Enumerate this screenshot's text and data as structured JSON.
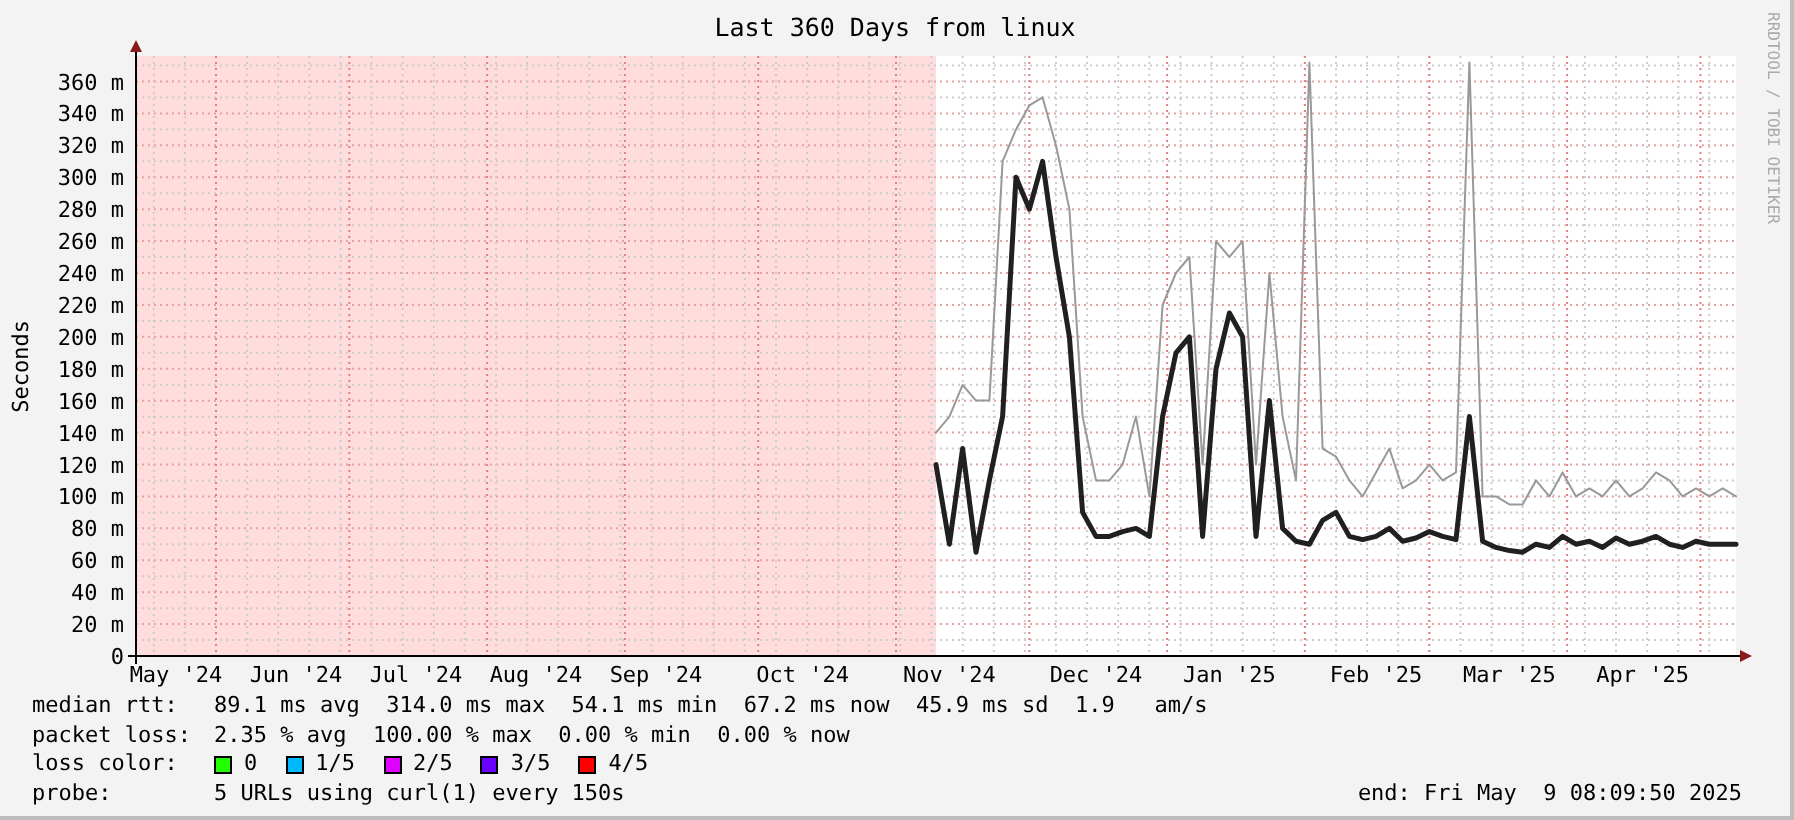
{
  "graph": {
    "chart_data": {
      "type": "line",
      "title": "Last 360 Days from linux",
      "ylabel": "Seconds",
      "ylim": [
        0,
        376
      ],
      "grid": true,
      "categories": [
        null,
        null,
        null,
        "May '24",
        null,
        null,
        null,
        null,
        null,
        null,
        null,
        null,
        "Jun '24",
        null,
        null,
        null,
        null,
        null,
        null,
        null,
        null,
        "Jul '24",
        null,
        null,
        null,
        null,
        null,
        null,
        null,
        null,
        "Aug '24",
        null,
        null,
        null,
        null,
        null,
        null,
        null,
        null,
        "Sep '24",
        null,
        null,
        null,
        null,
        null,
        null,
        null,
        null,
        null,
        null,
        "Oct '24",
        null,
        null,
        null,
        null,
        null,
        null,
        null,
        null,
        null,
        null,
        "Nov '24",
        null,
        null,
        null,
        null,
        null,
        null,
        null,
        null,
        null,
        null,
        "Dec '24",
        null,
        null,
        null,
        null,
        null,
        null,
        null,
        null,
        null,
        "Jan '25",
        null,
        null,
        null,
        null,
        null,
        null,
        null,
        null,
        null,
        null,
        "Feb '25",
        null,
        null,
        null,
        null,
        null,
        null,
        null,
        null,
        null,
        "Mar '25",
        null,
        null,
        null,
        null,
        null,
        null,
        null,
        null,
        null,
        "Apr '25",
        null,
        null,
        null,
        null,
        null,
        null,
        null
      ],
      "yticks": [
        {
          "value": 0,
          "label": "0"
        },
        {
          "value": 20,
          "label": "20 m"
        },
        {
          "value": 40,
          "label": "40 m"
        },
        {
          "value": 60,
          "label": "60 m"
        },
        {
          "value": 80,
          "label": "80 m"
        },
        {
          "value": 100,
          "label": "100 m"
        },
        {
          "value": 120,
          "label": "120 m"
        },
        {
          "value": 140,
          "label": "140 m"
        },
        {
          "value": 160,
          "label": "160 m"
        },
        {
          "value": 180,
          "label": "180 m"
        },
        {
          "value": 200,
          "label": "200 m"
        },
        {
          "value": 220,
          "label": "220 m"
        },
        {
          "value": 240,
          "label": "240 m"
        },
        {
          "value": 260,
          "label": "260 m"
        },
        {
          "value": 280,
          "label": "280 m"
        },
        {
          "value": 300,
          "label": "300 m"
        },
        {
          "value": 320,
          "label": "320 m"
        },
        {
          "value": 340,
          "label": "340 m"
        },
        {
          "value": 360,
          "label": "360 m"
        }
      ],
      "series": [
        {
          "color": "#999999",
          "values": [
            null,
            null,
            null,
            null,
            null,
            null,
            null,
            null,
            null,
            null,
            null,
            null,
            null,
            null,
            null,
            null,
            null,
            null,
            null,
            null,
            null,
            null,
            null,
            null,
            null,
            null,
            null,
            null,
            null,
            null,
            null,
            null,
            null,
            null,
            null,
            null,
            null,
            null,
            null,
            null,
            null,
            null,
            null,
            null,
            null,
            null,
            null,
            null,
            null,
            null,
            null,
            null,
            null,
            null,
            null,
            null,
            null,
            null,
            null,
            null,
            140,
            150,
            170,
            160,
            160,
            310,
            330,
            345,
            350,
            320,
            280,
            150,
            110,
            110,
            120,
            150,
            100,
            220,
            240,
            250,
            120,
            260,
            250,
            260,
            120,
            240,
            150,
            110,
            372,
            130,
            125,
            110,
            100,
            115,
            130,
            105,
            110,
            120,
            110,
            115,
            372,
            100,
            100,
            95,
            95,
            110,
            100,
            115,
            100,
            105,
            100,
            110,
            100,
            105,
            115,
            110,
            100,
            105,
            100,
            105,
            100
          ]
        },
        {
          "name": "median rtt:",
          "color": "#202020",
          "values": [
            null,
            null,
            null,
            null,
            null,
            null,
            null,
            null,
            null,
            null,
            null,
            null,
            null,
            null,
            null,
            null,
            null,
            null,
            null,
            null,
            null,
            null,
            null,
            null,
            null,
            null,
            null,
            null,
            null,
            null,
            null,
            null,
            null,
            null,
            null,
            null,
            null,
            null,
            null,
            null,
            null,
            null,
            null,
            null,
            null,
            null,
            null,
            null,
            null,
            null,
            null,
            null,
            null,
            null,
            null,
            null,
            null,
            null,
            null,
            null,
            120,
            70,
            130,
            65,
            110,
            150,
            300,
            280,
            310,
            250,
            200,
            90,
            75,
            75,
            78,
            80,
            75,
            150,
            190,
            200,
            75,
            180,
            215,
            200,
            75,
            160,
            80,
            72,
            70,
            85,
            90,
            75,
            73,
            75,
            80,
            72,
            74,
            78,
            75,
            73,
            150,
            72,
            68,
            66,
            65,
            70,
            68,
            75,
            70,
            72,
            68,
            74,
            70,
            72,
            75,
            70,
            68,
            72,
            70,
            70,
            70
          ]
        }
      ]
    },
    "credit": "RRDTOOL / TOBI OETIKER"
  },
  "legend": {
    "rows": [
      {
        "text": "89.1 ms avg  314.0 ms max  54.1 ms min  67.2 ms now  45.9 ms sd  1.9   am/s"
      },
      {
        "label": "packet loss:",
        "text": "2.35 % avg  100.00 % max  0.00 % min  0.00 % now"
      }
    ],
    "loss_color": {
      "label": "loss color:",
      "items": [
        {
          "label": "0",
          "color": "#22ff00"
        },
        {
          "label": "1/5",
          "color": "#00b8ff"
        },
        {
          "label": "2/5",
          "color": "#e000ff"
        },
        {
          "label": "3/5",
          "color": "#6a00ff"
        },
        {
          "label": "4/5",
          "color": "#ff0000"
        }
      ]
    },
    "probe": {
      "label": "probe:",
      "text": "5 URLs using curl(1) every 150s"
    },
    "end": "end: Fri May  9 08:09:50 2025"
  }
}
